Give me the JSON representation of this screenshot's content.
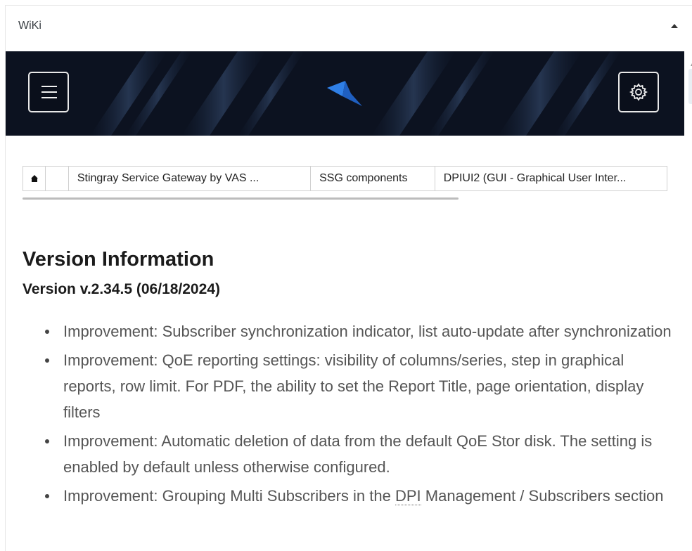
{
  "panel": {
    "title": "WiKi"
  },
  "breadcrumb": {
    "items": [
      {
        "label": "Stingray Service Gateway by VAS ..."
      },
      {
        "label": "SSG components"
      },
      {
        "label": "DPIUI2 (GUI - Graphical User Inter..."
      }
    ]
  },
  "content": {
    "heading": "Version Information",
    "subheading": "Version v.2.34.5 (06/18/2024)",
    "notes": [
      {
        "text": "Improvement: Subscriber synchronization indicator, list auto-update after synchronization"
      },
      {
        "text": "Improvement: QoE reporting settings: visibility of columns/series, step in graphical reports, row limit. For PDF, the ability to set the Report Title, page orientation, display filters"
      },
      {
        "text": "Improvement: Automatic deletion of data from the default QoE Stor disk. The setting is enabled by default unless otherwise configured."
      },
      {
        "text_before": "Improvement: Grouping Multi Subscribers in the ",
        "abbr": "DPI",
        "text_after": " Management / Subscribers section"
      }
    ]
  },
  "icons": {
    "menu": "hamburger-icon",
    "settings": "gear-icon",
    "home": "home-icon",
    "collapse": "caret-up-icon",
    "logo": "stingray-logo"
  },
  "colors": {
    "banner": "#0c1220",
    "logo": "#2f7fe6"
  }
}
